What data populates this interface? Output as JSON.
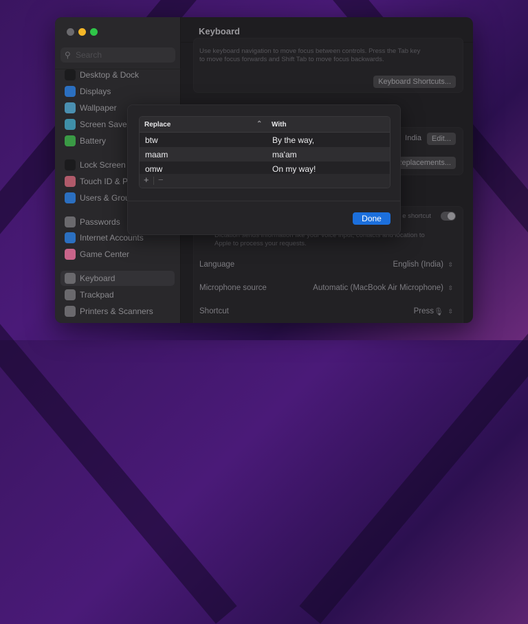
{
  "window": {
    "title": "Keyboard",
    "search_placeholder": "Search"
  },
  "sidebar": {
    "items": [
      {
        "label": "Desktop & Dock",
        "icon": "desktop-dock-icon",
        "color": "#1b1b1d"
      },
      {
        "label": "Displays",
        "icon": "displays-icon",
        "color": "#2b6fc0"
      },
      {
        "label": "Wallpaper",
        "icon": "wallpaper-icon",
        "color": "#4a8fb0"
      },
      {
        "label": "Screen Saver",
        "icon": "screen-saver-icon",
        "color": "#3f8fa8"
      },
      {
        "label": "Battery",
        "icon": "battery-icon",
        "color": "#3a9a45"
      },
      {
        "label": "Lock Screen",
        "icon": "lock-icon",
        "color": "#1b1b1d"
      },
      {
        "label": "Touch ID & Password",
        "icon": "fingerprint-icon",
        "color": "#b05a6a"
      },
      {
        "label": "Users & Groups",
        "icon": "users-icon",
        "color": "#2b6fc0"
      },
      {
        "label": "Passwords",
        "icon": "key-icon",
        "color": "#6a696d"
      },
      {
        "label": "Internet Accounts",
        "icon": "at-icon",
        "color": "#2b6fc0"
      },
      {
        "label": "Game Center",
        "icon": "game-center-icon",
        "color": "#c9648a"
      },
      {
        "label": "Keyboard",
        "icon": "keyboard-icon",
        "color": "#6a696d"
      },
      {
        "label": "Trackpad",
        "icon": "trackpad-icon",
        "color": "#6a696d"
      },
      {
        "label": "Printers & Scanners",
        "icon": "printer-icon",
        "color": "#6a696d"
      }
    ]
  },
  "content": {
    "nav_desc_1": "Use keyboard navigation to move focus between controls. Press the Tab key",
    "nav_desc_2": "to move focus forwards and Shift Tab to move focus backwards.",
    "keyboard_shortcuts_button": "Keyboard Shortcuts...",
    "input_source_value": "India",
    "edit_button": "Edit...",
    "text_replacements_button": "Text Replacements...",
    "shortcut_toggle_label": "e shortcut",
    "dictation_desc_1": "Dictation sends information like your voice input, contacts and location to",
    "dictation_desc_2": "Apple to process your requests.",
    "language_label": "Language",
    "language_value": "English (India)",
    "mic_label": "Microphone source",
    "mic_value": "Automatic (MacBook Air Microphone)",
    "shortcut_label": "Shortcut",
    "shortcut_value": "Press"
  },
  "sheet": {
    "columns": [
      "Replace",
      "With"
    ],
    "rows": [
      {
        "replace": "btw",
        "with": "By the way,"
      },
      {
        "replace": "maam",
        "with": "ma'am"
      },
      {
        "replace": "omw",
        "with": "On my way!"
      }
    ],
    "add": "+",
    "remove": "−",
    "done": "Done"
  }
}
